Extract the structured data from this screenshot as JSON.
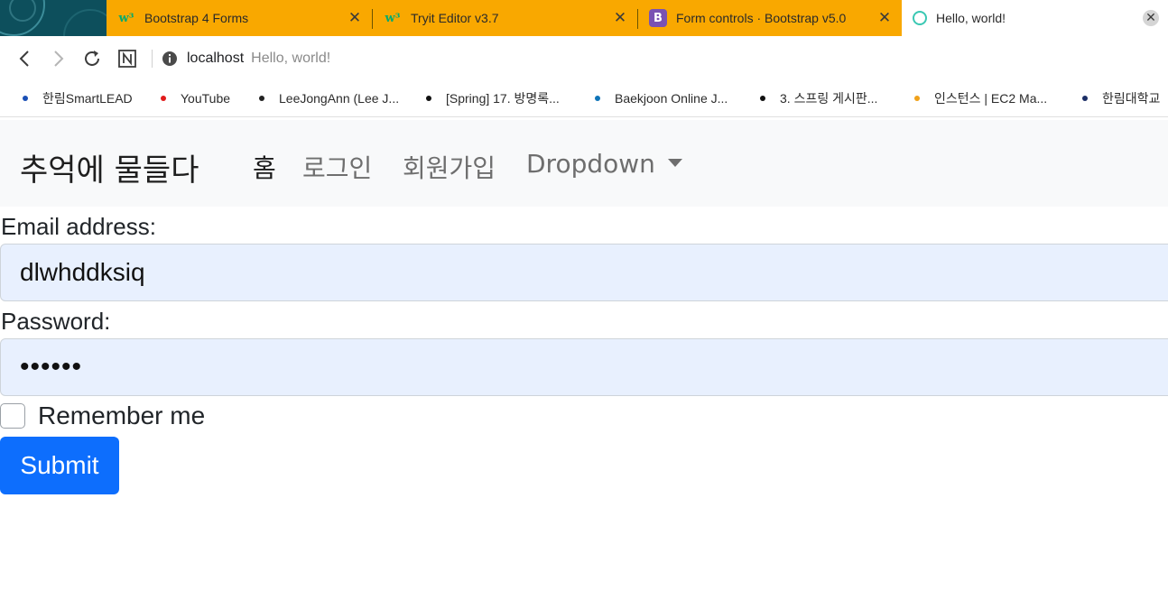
{
  "browser": {
    "tabs": [
      {
        "title": "Bootstrap 4 Forms",
        "favicon": "w3schools-icon"
      },
      {
        "title": "Tryit Editor v3.7",
        "favicon": "w3schools-icon"
      },
      {
        "title": "Form controls · Bootstrap v5.0",
        "favicon": "bootstrap-icon"
      },
      {
        "title": "Hello, world!",
        "favicon": "loading-spinner-icon",
        "active": true
      }
    ],
    "tab_close_glyph": "✕",
    "favicon_w3": "w³",
    "favicon_b": "B",
    "address": {
      "host": "localhost",
      "page_title": "Hello, world!"
    },
    "bookmarks": [
      {
        "label": "한림SmartLEAD",
        "color": "#1a4fb5"
      },
      {
        "label": "YouTube",
        "color": "#e11b1b"
      },
      {
        "label": "LeeJongAnn (Lee J...",
        "color": "#222222"
      },
      {
        "label": "[Spring] 17. 방명록...",
        "color": "#111111"
      },
      {
        "label": "Baekjoon Online J...",
        "color": "#0f74b8"
      },
      {
        "label": "3. 스프링 게시판...",
        "color": "#111111"
      },
      {
        "label": "인스턴스 | EC2 Ma...",
        "color": "#f0a11a"
      },
      {
        "label": "한림대학교",
        "color": "#1b2e66"
      }
    ],
    "colors": {
      "tab_strip": "#f9a800",
      "theme": "#0d4f5c"
    }
  },
  "navbar": {
    "brand": "추억에 물들다",
    "links": [
      {
        "label": "홈",
        "active": true
      },
      {
        "label": "로그인"
      },
      {
        "label": "회원가입"
      },
      {
        "label": "Dropdown"
      }
    ]
  },
  "form": {
    "email_label": "Email address:",
    "email_value": "dlwhddksiq",
    "password_label": "Password:",
    "password_value": "••••••",
    "remember_label": "Remember me",
    "remember_checked": false,
    "submit_label": "Submit"
  },
  "colors": {
    "primary": "#0d6efd",
    "autofill_bg": "#e8f0fe",
    "navbar_bg": "#f8f9fa"
  }
}
